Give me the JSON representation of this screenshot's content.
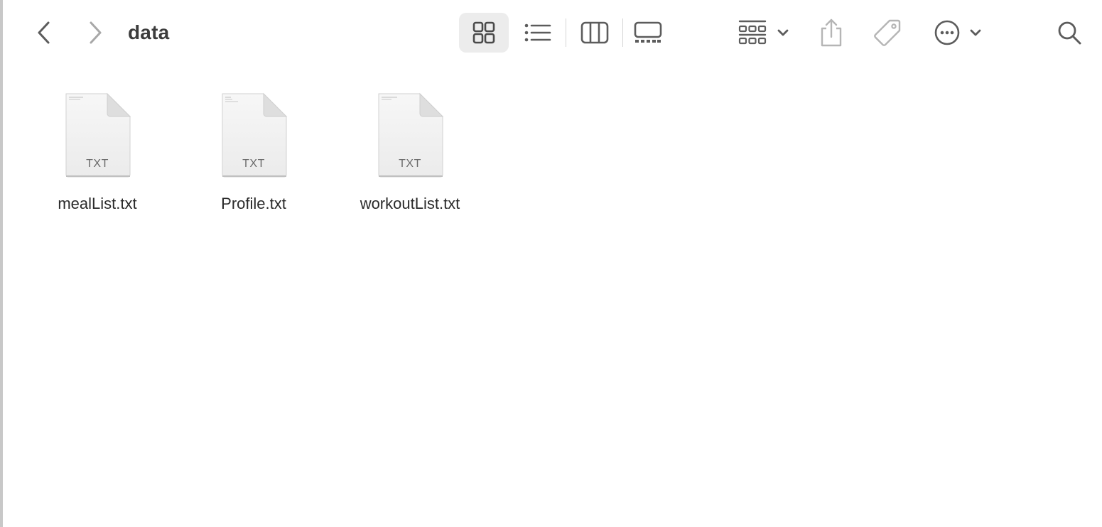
{
  "toolbar": {
    "back_icon": "chevron-left-icon",
    "forward_icon": "chevron-right-icon",
    "title": "data",
    "view_modes": [
      {
        "icon": "icon-view-icon",
        "selected": true
      },
      {
        "icon": "list-view-icon",
        "selected": false
      },
      {
        "icon": "column-view-icon",
        "selected": false
      },
      {
        "icon": "gallery-view-icon",
        "selected": false
      }
    ],
    "group_icon": "group-grid-icon",
    "share_icon": "share-icon",
    "tag_icon": "tag-icon",
    "more_icon": "ellipsis-circle-icon",
    "search_icon": "search-icon"
  },
  "files": [
    {
      "name": "mealList.txt",
      "ext": "TXT"
    },
    {
      "name": "Profile.txt",
      "ext": "TXT"
    },
    {
      "name": "workoutList.txt",
      "ext": "TXT"
    }
  ],
  "colors": {
    "icon_gray": "#5c5c5c",
    "disabled_gray": "#b5b5b5",
    "selected_bg": "#ececec",
    "title_text": "#3c3c3c"
  }
}
